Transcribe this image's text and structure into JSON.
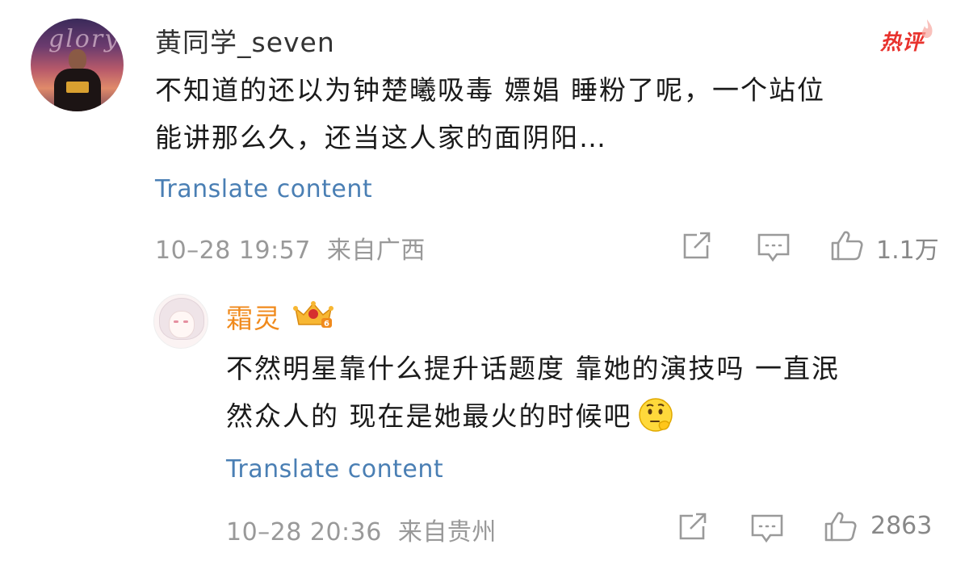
{
  "comment1": {
    "username": "黄同学_seven",
    "hot_badge": "热评",
    "text_line1": "不知道的还以为钟楚曦吸毒 嫖娼 睡粉了呢，一个站位",
    "text_line2": "能讲那么久，还当这人家的面阴阳…",
    "translate": "Translate content",
    "timestamp": "10–28 19:57",
    "location": "来自广西",
    "likes": "1.1万"
  },
  "reply1": {
    "username": "霜灵",
    "text_line1": "不然明星靠什么提升话题度 靠她的演技吗 一直泯",
    "text_line2": "然众人的 现在是她最火的时候吧",
    "emoji": "thinking-face-emoji",
    "translate": "Translate content",
    "timestamp": "10–28 20:36",
    "location": "来自贵州",
    "likes": "2863"
  },
  "colors": {
    "username": "#333333",
    "vip_username": "#f08a1c",
    "hot_badge": "#e8322d",
    "link": "#4a7fb4",
    "meta": "#999999"
  },
  "icons": [
    "share-icon",
    "comment-icon",
    "like-icon",
    "crown-badge-icon",
    "flame-icon"
  ]
}
